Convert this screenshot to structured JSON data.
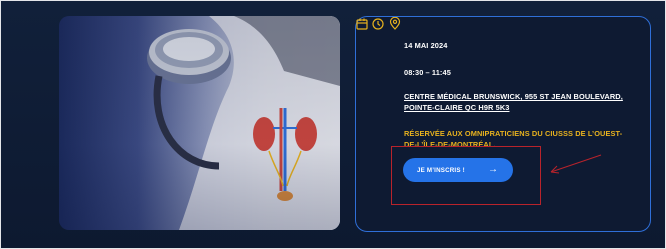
{
  "event": {
    "date": "14 MAI 2024",
    "time": "08:30 – 11:45",
    "address_line1": "CENTRE MÉDICAL BRUNSWICK, 955 ST JEAN BOULEVARD,",
    "address_line2": "POINTE-CLAIRE QC H9R 5K3",
    "note_line1": "RÉSERVÉE AUX OMNIPRATICIENS DU CIUSSS DE L’OUEST-",
    "note_line2": "DE-L’ÎLE-DE-MONTRÉAL.",
    "cta_label": "JE M’INSCRIS !",
    "cta_arrow": "→"
  },
  "icons": {
    "date": "calendar-icon",
    "time": "clock-icon",
    "location": "map-pin-icon",
    "cta": "arrow-right-icon"
  },
  "colors": {
    "background": "#0f1a30",
    "card_border": "#2f6fd8",
    "icon_accent": "#e8b21e",
    "note_text": "#e8b21e",
    "button": "#2573e8",
    "annotation": "#b8232b"
  }
}
